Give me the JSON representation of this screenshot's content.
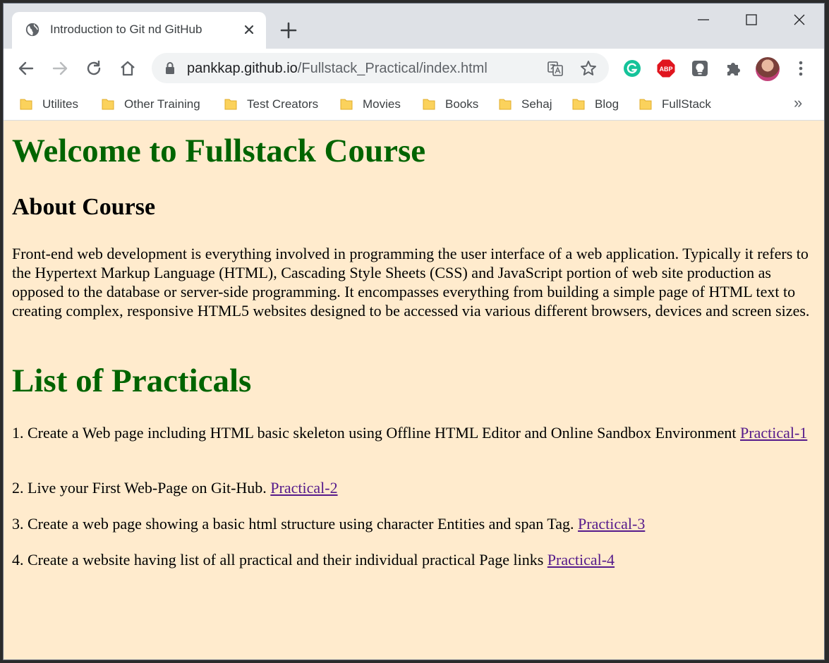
{
  "tab": {
    "title": "Introduction to Git nd GitHub",
    "favicon": "globe-icon"
  },
  "address_bar": {
    "host": "pankkap.github.io",
    "path": "/Fullstack_Practical/index.html"
  },
  "bookmarks": [
    {
      "label": "Utilites"
    },
    {
      "label": "Other Training"
    },
    {
      "label": "Test Creators"
    },
    {
      "label": "Movies"
    },
    {
      "label": "Books"
    },
    {
      "label": "Sehaj"
    },
    {
      "label": "Blog"
    },
    {
      "label": "FullStack"
    }
  ],
  "bookmarks_overflow": "»",
  "extensions": {
    "abp_label": "ABP"
  },
  "page": {
    "heading": "Welcome to Fullstack Course",
    "about_heading": "About Course",
    "about_text": "Front-end web development is everything involved in programming the user interface of a web application. Typically it refers to the Hypertext Markup Language (HTML), Cascading Style Sheets (CSS) and JavaScript portion of web site production as opposed to the database or server-side programming. It encompasses everything from building a simple page of HTML text to creating complex, responsive HTML5 websites designed to be accessed via various different browsers, devices and screen sizes.",
    "list_heading": "List of Practicals",
    "practicals": [
      {
        "text": "1. Create a Web page including HTML basic skeleton using Offline HTML Editor and Online Sandbox Environment",
        "link": "Practical-1"
      },
      {
        "text": "2. Live your First Web-Page on Git-Hub.",
        "link": "Practical-2"
      },
      {
        "text": "3. Create a web page showing a basic html structure using character Entities and span Tag.",
        "link": "Practical-3"
      },
      {
        "text": "4. Create a website having list of all practical and their individual practical Page links",
        "link": "Practical-4"
      }
    ]
  },
  "colors": {
    "page_background": "#ffebcd",
    "heading_green": "#006400",
    "visited_link": "#551a8b",
    "folder_yellow": "#fbd25c"
  }
}
